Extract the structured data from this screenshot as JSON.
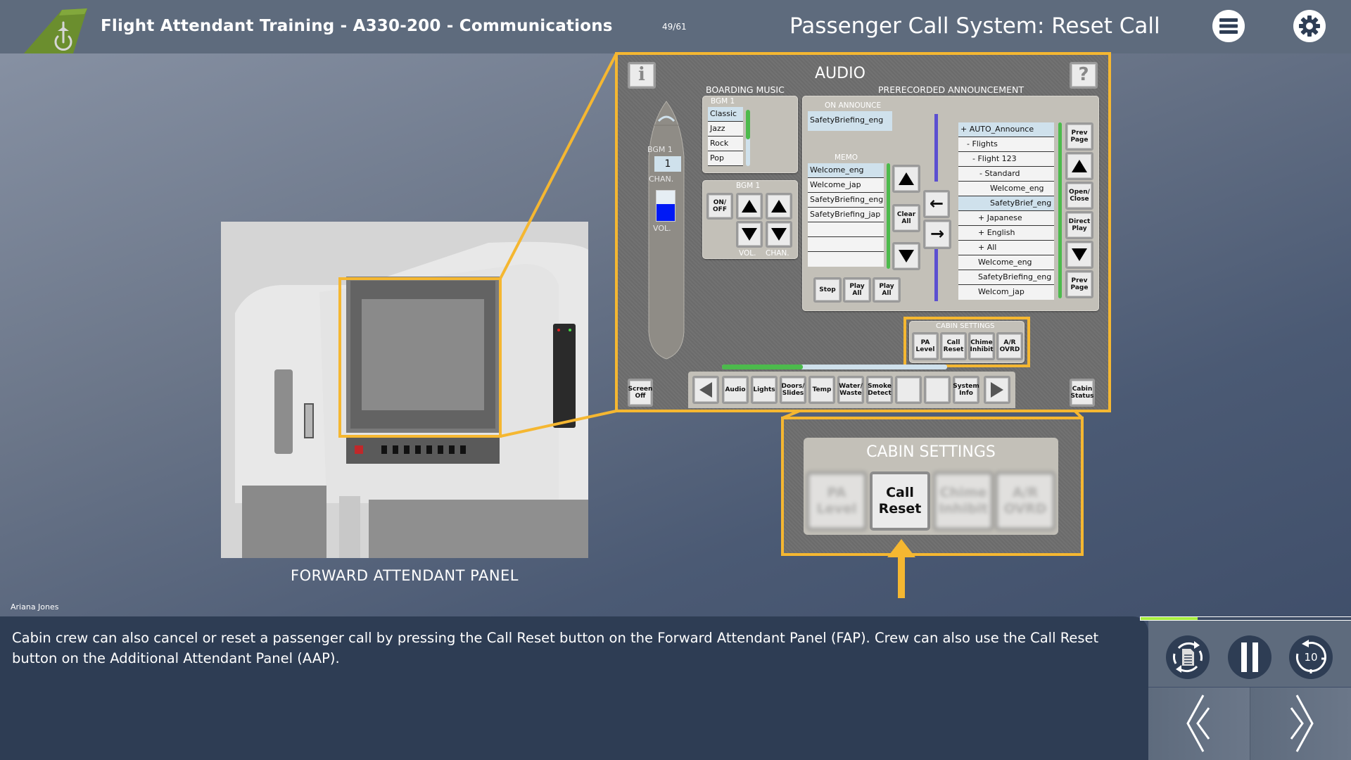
{
  "header": {
    "course_title": "Flight Attendant Training - A330-200 - Communications",
    "page_counter": "49/61",
    "slide_title": "Passenger Call System: Reset Call",
    "menu_icon": "hamburger-menu-icon",
    "settings_icon": "gear-icon",
    "logo_icon": "airline-tail-logo-icon"
  },
  "figure": {
    "caption": "FORWARD ATTENDANT PANEL",
    "author": "Ariana Jones"
  },
  "audio_panel": {
    "title": "AUDIO",
    "info_label": "i",
    "help_label": "?",
    "boarding_music_label": "BOARDING MUSIC",
    "prerecorded_label": "PRERECORDED ANNOUNCEMENT",
    "aircraft": {
      "bgm_label": "BGM 1",
      "channel_value": "1",
      "chan_label": "CHAN.",
      "vol_label": "VOL.",
      "volume_fraction": 0.55
    },
    "bgm_list": {
      "title": "BGM 1",
      "items": [
        "Classic",
        "Jazz",
        "Rock",
        "Pop"
      ],
      "selected": "Classic"
    },
    "bgm_controls": {
      "title": "BGM 1",
      "on_off": "ON/ OFF",
      "vol_label": "VOL.",
      "chan_label": "CHAN."
    },
    "on_announce": {
      "title": "ON ANNOUNCE",
      "value": "SafetyBriefing_eng"
    },
    "memo": {
      "title": "MEMO",
      "items": [
        "Welcome_eng",
        "Welcome_jap",
        "SafetyBriefing_eng",
        "SafetyBriefing_jap",
        "",
        "",
        ""
      ],
      "selected": "Welcome_eng",
      "clear_all": "Clear All",
      "stop": "Stop",
      "play_all_1": "Play All",
      "play_all_2": "Play All"
    },
    "select_tree": {
      "items": [
        "+ AUTO_Announce",
        "- Flights",
        "- Flight 123",
        "- Standard",
        "Welcome_eng",
        "SafetyBrief_eng",
        "+ Japanese",
        "+ English",
        "+ All",
        "Welcome_eng",
        "SafetyBriefing_eng",
        "Welcom_jap"
      ],
      "selected": [
        "+ AUTO_Announce",
        "SafetyBrief_eng"
      ],
      "side_buttons": [
        "Prev Page",
        "Open/ Close",
        "Direct Play",
        "Prev Page"
      ]
    },
    "cabin_settings": {
      "title": "CABIN SETTINGS",
      "buttons": [
        "PA Level",
        "Call Reset",
        "Chime Inhibit",
        "A/R OVRD"
      ]
    },
    "screen_off": "Screen Off",
    "cabin_status": "Cabin Status",
    "nav_tabs": [
      "Audio",
      "Lights",
      "Doors/ Slides",
      "Temp",
      "Water/ Waste",
      "Smoke Detect",
      "",
      "",
      "System Info"
    ],
    "nav_progress_fraction": 0.36
  },
  "callout": {
    "title": "CABIN SETTINGS",
    "buttons": [
      "PA Level",
      "Call Reset",
      "Chime Inhibit",
      "A/R OVRD"
    ],
    "highlighted": "Call Reset"
  },
  "narration": {
    "text": "Cabin crew can also cancel or reset a passenger call by pressing the Call Reset button on the Forward Attendant Panel (FAP). Crew can also use the Call Reset button on the Additional Attendant Panel (AAP)."
  },
  "controls": {
    "progress_fraction": 0.27,
    "replay_icon": "replay-transcript-icon",
    "pause_icon": "pause-icon",
    "rewind_icon": "rewind-10-icon",
    "rewind_label": "10",
    "prev_icon": "double-chevron-left-icon",
    "next_icon": "double-chevron-right-icon"
  },
  "colors": {
    "accent_yellow": "#f5b731",
    "header_bg": "#5e6b7d",
    "narration_bg": "#2e3d54",
    "progress_green": "#a7ee3f",
    "list_select": "#cfe1ec",
    "scroll_green": "#4cba4c",
    "logo_green": "#6b8e2e"
  }
}
